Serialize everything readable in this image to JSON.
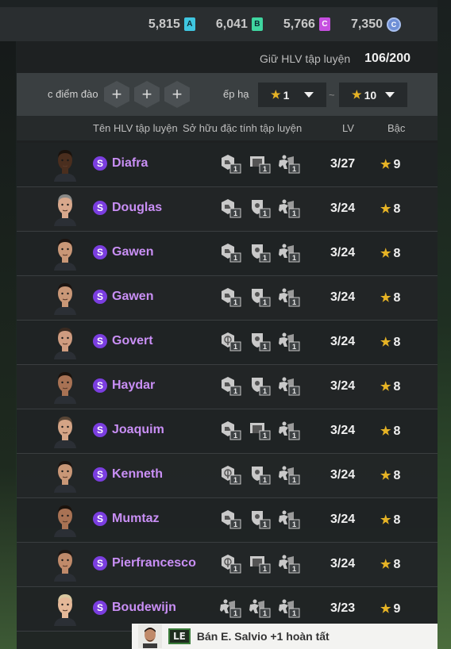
{
  "currency": [
    {
      "value": "5,815",
      "badge": "A",
      "color": "#3fc6e0"
    },
    {
      "value": "6,041",
      "badge": "B",
      "color": "#3fd6a0"
    },
    {
      "value": "5,766",
      "badge": "C",
      "color": "#c64fe0"
    },
    {
      "value": "7,350",
      "badge": "coin",
      "color": "#6e8fd6"
    }
  ],
  "capacity": {
    "label": "Giữ HLV tập luyện",
    "value": "106/200"
  },
  "filter": {
    "trait_label": "c điểm đào",
    "add_symbol": "+",
    "rank_label": "ếp hạ",
    "rank_from": "1",
    "rank_to": "10",
    "range_sep": "~"
  },
  "columns": {
    "name": "Tên HLV tập luyện",
    "traits": "Sở hữu đặc tính tập luyện",
    "lv": "LV",
    "grade": "Bậc"
  },
  "rows": [
    {
      "name": "Diafra",
      "lv": "3/27",
      "grade": "9",
      "skin": "#4a2e1e",
      "hair": "#1a120c",
      "traits": [
        "boot",
        "goal",
        "player"
      ]
    },
    {
      "name": "Douglas",
      "lv": "3/24",
      "grade": "8",
      "skin": "#d8a88c",
      "hair": "#8a8a88",
      "traits": [
        "boot",
        "shield",
        "player"
      ]
    },
    {
      "name": "Gawen",
      "lv": "3/24",
      "grade": "8",
      "skin": "#c99777",
      "hair": "#1c1410",
      "traits": [
        "boot",
        "shield",
        "player"
      ]
    },
    {
      "name": "Gawen",
      "lv": "3/24",
      "grade": "8",
      "skin": "#c99777",
      "hair": "#1c1410",
      "traits": [
        "boot",
        "shield",
        "player"
      ]
    },
    {
      "name": "Govert",
      "lv": "3/24",
      "grade": "8",
      "skin": "#cf9c80",
      "hair": "#3a2a20",
      "traits": [
        "target",
        "shield",
        "player"
      ]
    },
    {
      "name": "Haydar",
      "lv": "3/24",
      "grade": "8",
      "skin": "#a87254",
      "hair": "#1a120c",
      "traits": [
        "boot",
        "shield",
        "player"
      ]
    },
    {
      "name": "Joaquim",
      "lv": "3/24",
      "grade": "8",
      "skin": "#d4a486",
      "hair": "#5a4636",
      "traits": [
        "boot",
        "goal",
        "player"
      ]
    },
    {
      "name": "Kenneth",
      "lv": "3/24",
      "grade": "8",
      "skin": "#c99777",
      "hair": "#1c1410",
      "traits": [
        "target",
        "shield",
        "player"
      ]
    },
    {
      "name": "Mumtaz",
      "lv": "3/24",
      "grade": "8",
      "skin": "#a87254",
      "hair": "#1a120c",
      "traits": [
        "boot",
        "shield",
        "player"
      ]
    },
    {
      "name": "Pierfrancesco",
      "lv": "3/24",
      "grade": "8",
      "skin": "#c08a6a",
      "hair": "#1e1612",
      "traits": [
        "target",
        "goal",
        "player"
      ]
    },
    {
      "name": "Boudewijn",
      "lv": "3/23",
      "grade": "9",
      "skin": "#e4b898",
      "hair": "#d8c8a0",
      "traits": [
        "player",
        "player",
        "player"
      ]
    }
  ],
  "trait_level": "1",
  "toast": {
    "position": "LE",
    "text": "Bán E. Salvio +1 hoàn tất"
  }
}
